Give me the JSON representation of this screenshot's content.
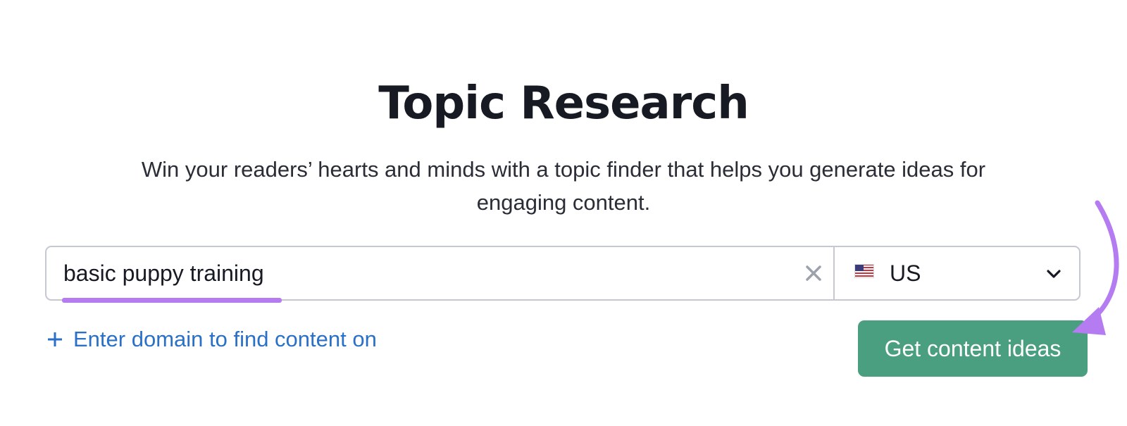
{
  "header": {
    "title": "Topic Research",
    "subtitle": "Win your readers’ hearts and minds with a topic finder that helps you generate ideas for engaging content."
  },
  "search": {
    "keyword_value": "basic puppy training",
    "clear_icon": "close-icon",
    "country": {
      "flag_icon": "us-flag-icon",
      "selected": "US",
      "dropdown_icon": "chevron-down-icon"
    }
  },
  "domain_link": {
    "icon": "plus-icon",
    "label": "Enter domain to find content on"
  },
  "cta": {
    "label": "Get content ideas"
  },
  "colors": {
    "cta_background": "#4a9f80",
    "link": "#2a70c7",
    "annotation_accent": "#b57cf2",
    "border": "#c5c8d0"
  }
}
